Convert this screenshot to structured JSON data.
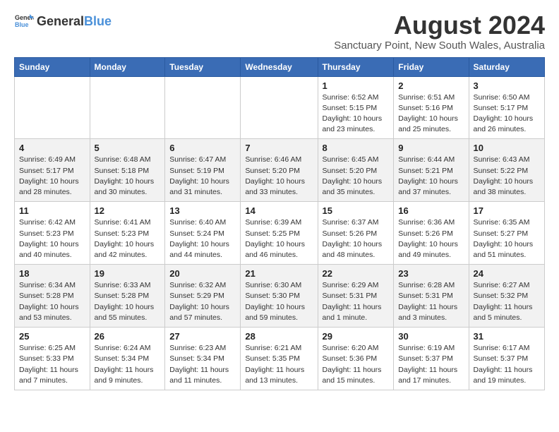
{
  "logo": {
    "general": "General",
    "blue": "Blue"
  },
  "title": "August 2024",
  "location": "Sanctuary Point, New South Wales, Australia",
  "days_of_week": [
    "Sunday",
    "Monday",
    "Tuesday",
    "Wednesday",
    "Thursday",
    "Friday",
    "Saturday"
  ],
  "weeks": [
    [
      {
        "num": "",
        "info": ""
      },
      {
        "num": "",
        "info": ""
      },
      {
        "num": "",
        "info": ""
      },
      {
        "num": "",
        "info": ""
      },
      {
        "num": "1",
        "info": "Sunrise: 6:52 AM\nSunset: 5:15 PM\nDaylight: 10 hours\nand 23 minutes."
      },
      {
        "num": "2",
        "info": "Sunrise: 6:51 AM\nSunset: 5:16 PM\nDaylight: 10 hours\nand 25 minutes."
      },
      {
        "num": "3",
        "info": "Sunrise: 6:50 AM\nSunset: 5:17 PM\nDaylight: 10 hours\nand 26 minutes."
      }
    ],
    [
      {
        "num": "4",
        "info": "Sunrise: 6:49 AM\nSunset: 5:17 PM\nDaylight: 10 hours\nand 28 minutes."
      },
      {
        "num": "5",
        "info": "Sunrise: 6:48 AM\nSunset: 5:18 PM\nDaylight: 10 hours\nand 30 minutes."
      },
      {
        "num": "6",
        "info": "Sunrise: 6:47 AM\nSunset: 5:19 PM\nDaylight: 10 hours\nand 31 minutes."
      },
      {
        "num": "7",
        "info": "Sunrise: 6:46 AM\nSunset: 5:20 PM\nDaylight: 10 hours\nand 33 minutes."
      },
      {
        "num": "8",
        "info": "Sunrise: 6:45 AM\nSunset: 5:20 PM\nDaylight: 10 hours\nand 35 minutes."
      },
      {
        "num": "9",
        "info": "Sunrise: 6:44 AM\nSunset: 5:21 PM\nDaylight: 10 hours\nand 37 minutes."
      },
      {
        "num": "10",
        "info": "Sunrise: 6:43 AM\nSunset: 5:22 PM\nDaylight: 10 hours\nand 38 minutes."
      }
    ],
    [
      {
        "num": "11",
        "info": "Sunrise: 6:42 AM\nSunset: 5:23 PM\nDaylight: 10 hours\nand 40 minutes."
      },
      {
        "num": "12",
        "info": "Sunrise: 6:41 AM\nSunset: 5:23 PM\nDaylight: 10 hours\nand 42 minutes."
      },
      {
        "num": "13",
        "info": "Sunrise: 6:40 AM\nSunset: 5:24 PM\nDaylight: 10 hours\nand 44 minutes."
      },
      {
        "num": "14",
        "info": "Sunrise: 6:39 AM\nSunset: 5:25 PM\nDaylight: 10 hours\nand 46 minutes."
      },
      {
        "num": "15",
        "info": "Sunrise: 6:37 AM\nSunset: 5:26 PM\nDaylight: 10 hours\nand 48 minutes."
      },
      {
        "num": "16",
        "info": "Sunrise: 6:36 AM\nSunset: 5:26 PM\nDaylight: 10 hours\nand 49 minutes."
      },
      {
        "num": "17",
        "info": "Sunrise: 6:35 AM\nSunset: 5:27 PM\nDaylight: 10 hours\nand 51 minutes."
      }
    ],
    [
      {
        "num": "18",
        "info": "Sunrise: 6:34 AM\nSunset: 5:28 PM\nDaylight: 10 hours\nand 53 minutes."
      },
      {
        "num": "19",
        "info": "Sunrise: 6:33 AM\nSunset: 5:28 PM\nDaylight: 10 hours\nand 55 minutes."
      },
      {
        "num": "20",
        "info": "Sunrise: 6:32 AM\nSunset: 5:29 PM\nDaylight: 10 hours\nand 57 minutes."
      },
      {
        "num": "21",
        "info": "Sunrise: 6:30 AM\nSunset: 5:30 PM\nDaylight: 10 hours\nand 59 minutes."
      },
      {
        "num": "22",
        "info": "Sunrise: 6:29 AM\nSunset: 5:31 PM\nDaylight: 11 hours\nand 1 minute."
      },
      {
        "num": "23",
        "info": "Sunrise: 6:28 AM\nSunset: 5:31 PM\nDaylight: 11 hours\nand 3 minutes."
      },
      {
        "num": "24",
        "info": "Sunrise: 6:27 AM\nSunset: 5:32 PM\nDaylight: 11 hours\nand 5 minutes."
      }
    ],
    [
      {
        "num": "25",
        "info": "Sunrise: 6:25 AM\nSunset: 5:33 PM\nDaylight: 11 hours\nand 7 minutes."
      },
      {
        "num": "26",
        "info": "Sunrise: 6:24 AM\nSunset: 5:34 PM\nDaylight: 11 hours\nand 9 minutes."
      },
      {
        "num": "27",
        "info": "Sunrise: 6:23 AM\nSunset: 5:34 PM\nDaylight: 11 hours\nand 11 minutes."
      },
      {
        "num": "28",
        "info": "Sunrise: 6:21 AM\nSunset: 5:35 PM\nDaylight: 11 hours\nand 13 minutes."
      },
      {
        "num": "29",
        "info": "Sunrise: 6:20 AM\nSunset: 5:36 PM\nDaylight: 11 hours\nand 15 minutes."
      },
      {
        "num": "30",
        "info": "Sunrise: 6:19 AM\nSunset: 5:37 PM\nDaylight: 11 hours\nand 17 minutes."
      },
      {
        "num": "31",
        "info": "Sunrise: 6:17 AM\nSunset: 5:37 PM\nDaylight: 11 hours\nand 19 minutes."
      }
    ]
  ]
}
